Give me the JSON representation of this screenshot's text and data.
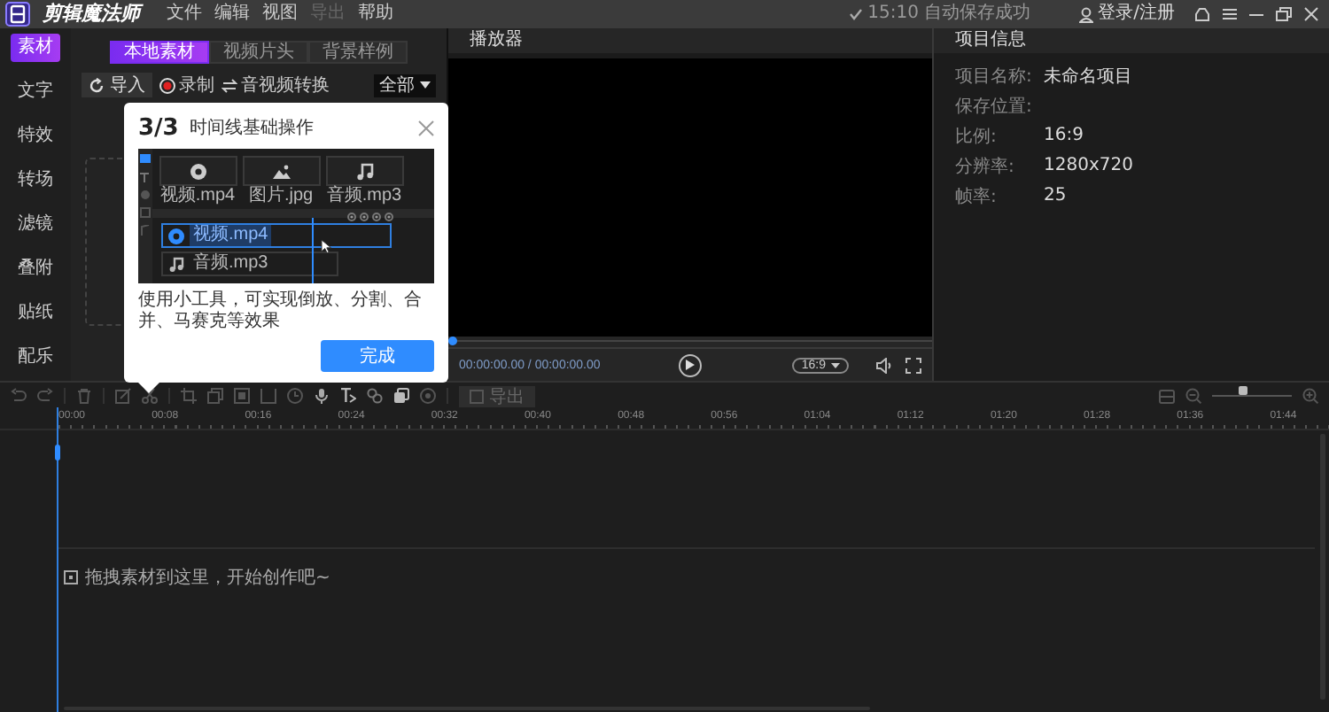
{
  "app": {
    "title": "剪辑魔法师",
    "menu": [
      {
        "label": "文件",
        "disabled": false
      },
      {
        "label": "编辑",
        "disabled": false
      },
      {
        "label": "视图",
        "disabled": false
      },
      {
        "label": "导出",
        "disabled": true
      },
      {
        "label": "帮助",
        "disabled": false
      }
    ],
    "autosave": "15:10 自动保存成功",
    "login": "登录/注册"
  },
  "sidebar": [
    {
      "label": "素材",
      "selected": true
    },
    {
      "label": "文字",
      "selected": false
    },
    {
      "label": "特效",
      "selected": false
    },
    {
      "label": "转场",
      "selected": false
    },
    {
      "label": "滤镜",
      "selected": false
    },
    {
      "label": "叠附",
      "selected": false
    },
    {
      "label": "贴纸",
      "selected": false
    },
    {
      "label": "配乐",
      "selected": false
    }
  ],
  "media": {
    "tabs": [
      {
        "label": "本地素材",
        "selected": true
      },
      {
        "label": "视频片头",
        "selected": false
      },
      {
        "label": "背景样例",
        "selected": false
      }
    ],
    "import": "导入",
    "record": "录制",
    "convert": "音视频转换",
    "filter": "全部"
  },
  "player": {
    "title": "播放器",
    "level": 0,
    "time": "00:00:00.00 / 00:00:00.00",
    "ratio": "16:9"
  },
  "project": {
    "title": "项目信息",
    "fields": [
      {
        "label": "项目名称:",
        "value": "未命名项目"
      },
      {
        "label": "保存位置:"
      },
      {
        "label": "比例:",
        "value": "16:9"
      },
      {
        "label": "分辨率:",
        "value": "1280x720"
      },
      {
        "label": "帧率:",
        "value": "25"
      }
    ]
  },
  "timeline": {
    "export": {
      "label": "导出",
      "disabled": true
    },
    "zoom": {
      "level": 0.38
    },
    "ticks": [
      "00:00",
      "00:08",
      "00:16",
      "00:24",
      "00:32",
      "00:40",
      "00:48",
      "00:56",
      "01:04",
      "01:12",
      "01:20",
      "01:28",
      "01:36",
      "01:44"
    ],
    "hint": "拖拽素材到这里，开始创作吧~"
  },
  "guide": {
    "step": "3/3",
    "title": "时间线基础操作",
    "files": [
      "视频.mp4",
      "图片.jpg",
      "音频.mp3"
    ],
    "tracks": [
      {
        "label": "视频.mp4",
        "selected": true
      },
      {
        "label": "音频.mp3",
        "selected": false
      }
    ],
    "description": "使用小工具，可实现倒放、分割、合并、马赛克等效果",
    "button": "完成"
  }
}
